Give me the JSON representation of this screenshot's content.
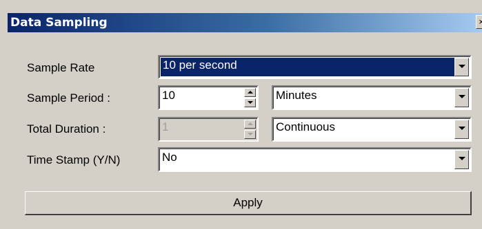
{
  "window": {
    "title": "Data Sampling",
    "close_glyph": "×"
  },
  "rows": {
    "sample_rate": {
      "label": "Sample Rate",
      "value": "10 per second"
    },
    "sample_period": {
      "label": "Sample Period :",
      "value": "10",
      "unit": "Minutes"
    },
    "total_duration": {
      "label": "Total Duration :",
      "value": "1",
      "unit": "Continuous"
    },
    "time_stamp": {
      "label": "Time Stamp (Y/N)",
      "value": "No"
    }
  },
  "apply_label": "Apply",
  "colors": {
    "dialog_bg": "#d4d0c8",
    "title_start": "#0a246a",
    "title_end": "#a6caf0",
    "selection": "#0a246a"
  },
  "icons": {
    "dropdown": "chevron-down-icon",
    "spin_up": "spin-up-icon",
    "spin_down": "spin-down-icon",
    "close": "close-icon"
  }
}
